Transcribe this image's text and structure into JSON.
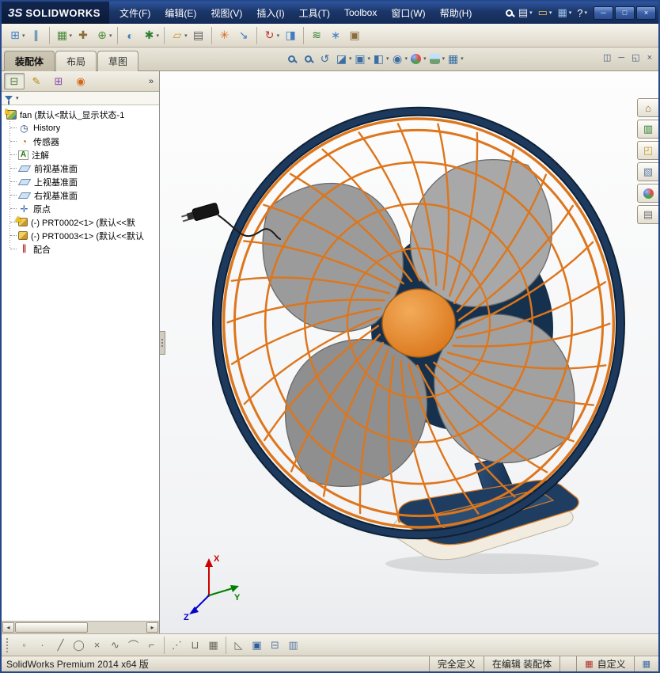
{
  "titlebar": {
    "logo_mark": "3S",
    "logo_text": "SOLIDWORKS",
    "menus": [
      "文件(F)",
      "编辑(E)",
      "视图(V)",
      "插入(I)",
      "工具(T)",
      "Toolbox",
      "窗口(W)",
      "帮助(H)"
    ],
    "quick_icons": [
      {
        "name": "search",
        "kind": "mag"
      },
      {
        "name": "new-document",
        "glyph": "▤",
        "color": "#e9eef7",
        "caret": true
      },
      {
        "name": "open",
        "glyph": "▭",
        "color": "#f0c050",
        "caret": true
      },
      {
        "name": "save",
        "glyph": "▦",
        "color": "#9cc2ee",
        "caret": true
      },
      {
        "name": "help",
        "glyph": "?",
        "color": "#ffffff",
        "caret": true
      }
    ],
    "window_controls": [
      {
        "name": "minimize",
        "glyph": "─"
      },
      {
        "name": "maximize",
        "glyph": "□"
      },
      {
        "name": "close",
        "glyph": "×"
      }
    ]
  },
  "toolbar": {
    "icons": [
      {
        "name": "insert-components",
        "glyph": "⊞",
        "color": "#3f7ec2",
        "caret": true
      },
      {
        "name": "mate",
        "glyph": "∥",
        "color": "#2e6da4"
      },
      {
        "name": "linear-component-pattern",
        "glyph": "▦",
        "color": "#4a8a3a",
        "caret": true,
        "sep": true
      },
      {
        "name": "smart-fasteners",
        "glyph": "✚",
        "color": "#8a6d3b"
      },
      {
        "name": "move-component",
        "glyph": "⊕",
        "color": "#4a8a3a",
        "caret": true
      },
      {
        "name": "show-hidden-components",
        "glyph": "◐",
        "color": "#3f7ec2",
        "sep": true
      },
      {
        "name": "assembly-features",
        "glyph": "✱",
        "color": "#2e7d32",
        "caret": true
      },
      {
        "name": "reference-geometry",
        "glyph": "▱",
        "color": "#c79a2e",
        "caret": true,
        "sep": true
      },
      {
        "name": "bill-of-materials",
        "glyph": "▤",
        "color": "#5a5a5a"
      },
      {
        "name": "exploded-view",
        "glyph": "✳",
        "color": "#d2691e",
        "sep": true
      },
      {
        "name": "instant-3d",
        "glyph": "↘",
        "color": "#3f7ec2"
      },
      {
        "name": "rebuild",
        "glyph": "↻",
        "color": "#c0392b",
        "caret": true,
        "sep": true
      },
      {
        "name": "snapshot",
        "glyph": "◨",
        "color": "#3f7ec2"
      },
      {
        "name": "motion-study",
        "glyph": "≋",
        "color": "#2e7d32",
        "sep": true
      },
      {
        "name": "measure",
        "glyph": "∗",
        "color": "#3f7ec2"
      },
      {
        "name": "mass-properties",
        "glyph": "▣",
        "color": "#8a6d3b"
      }
    ]
  },
  "band": {
    "tabs": [
      {
        "label": "装配体",
        "active": true
      },
      {
        "label": "布局",
        "active": false
      },
      {
        "label": "草图",
        "active": false
      }
    ],
    "headsup": [
      {
        "name": "zoom-to-fit",
        "kind": "mag"
      },
      {
        "name": "zoom-to-area",
        "kind": "mag"
      },
      {
        "name": "previous-view",
        "glyph": "↺",
        "color": "#3a6ea5"
      },
      {
        "name": "section-view",
        "glyph": "◪",
        "color": "#3a6ea5",
        "caret": true
      },
      {
        "name": "view-orientation",
        "glyph": "▣",
        "color": "#3a6ea5",
        "caret": true
      },
      {
        "name": "display-style",
        "glyph": "◧",
        "color": "#3a6ea5",
        "caret": true
      },
      {
        "name": "hide-show-items",
        "glyph": "◉",
        "color": "#3a6ea5",
        "caret": true
      },
      {
        "name": "edit-appearance",
        "kind": "ball",
        "caret": true
      },
      {
        "name": "apply-scene",
        "kind": "scene",
        "caret": true
      },
      {
        "name": "view-settings",
        "glyph": "▦",
        "color": "#3a6ea5",
        "caret": true
      }
    ],
    "doc_controls": [
      {
        "name": "viewport-layout",
        "glyph": "◫"
      },
      {
        "name": "doc-minimize",
        "glyph": "─"
      },
      {
        "name": "doc-restore",
        "glyph": "◱"
      },
      {
        "name": "doc-close",
        "glyph": "×"
      }
    ]
  },
  "panel": {
    "manager_tabs": [
      {
        "name": "feature-manager-tab",
        "glyph": "⊟",
        "color": "#4a7c2f",
        "active": true
      },
      {
        "name": "property-manager-tab",
        "glyph": "✎",
        "color": "#b8860b",
        "active": false
      },
      {
        "name": "configuration-manager-tab",
        "glyph": "⊞",
        "color": "#8e44ad",
        "active": false
      },
      {
        "name": "display-manager-tab",
        "glyph": "◉",
        "color": "#d2691e",
        "active": false
      }
    ],
    "overflow_glyph": "»",
    "tree": [
      {
        "icon": "assembly-icon",
        "warn": true,
        "label": "fan (默认<默认_显示状态-1"
      },
      {
        "icon": "history-icon",
        "warn": false,
        "label": "History"
      },
      {
        "icon": "sensors-icon",
        "warn": false,
        "label": "传感器"
      },
      {
        "icon": "annotations-icon",
        "warn": false,
        "label": "注解"
      },
      {
        "icon": "plane-icon",
        "warn": false,
        "label": "前视基准面"
      },
      {
        "icon": "plane-icon",
        "warn": false,
        "label": "上视基准面"
      },
      {
        "icon": "plane-icon",
        "warn": false,
        "label": "右视基准面"
      },
      {
        "icon": "origin-icon",
        "warn": false,
        "label": "原点"
      },
      {
        "icon": "part-icon",
        "warn": true,
        "label": "(-) PRT0002<1> (默认<<默"
      },
      {
        "icon": "part-icon",
        "warn": false,
        "label": "(-) PRT0003<1> (默认<<默认"
      },
      {
        "icon": "mates-icon",
        "warn": false,
        "label": "配合"
      }
    ]
  },
  "taskpane": [
    {
      "name": "solidworks-resources",
      "glyph": "⌂",
      "color": "#8a6d3b"
    },
    {
      "name": "design-library",
      "glyph": "▥",
      "color": "#2e7d32"
    },
    {
      "name": "file-explorer",
      "glyph": "◰",
      "color": "#c79a2e"
    },
    {
      "name": "view-palette",
      "glyph": "▧",
      "color": "#5b7aa5"
    },
    {
      "name": "appearances",
      "kind": "ball"
    },
    {
      "name": "custom-properties",
      "glyph": "▤",
      "color": "#707070"
    }
  ],
  "bottombar": [
    {
      "name": "select-tool",
      "glyph": "◦",
      "color": "#6b6b5e"
    },
    {
      "name": "sketch-point",
      "glyph": "·",
      "color": "#6b6b5e"
    },
    {
      "name": "sketch-line",
      "glyph": "╱",
      "color": "#6b6b5e"
    },
    {
      "name": "sketch-circle",
      "glyph": "◯",
      "color": "#6b6b5e"
    },
    {
      "name": "sketch-cross",
      "glyph": "×",
      "color": "#6b6b5e"
    },
    {
      "name": "sketch-spline",
      "glyph": "∿",
      "color": "#6b6b5e"
    },
    {
      "name": "sketch-arc",
      "glyph": "⌒",
      "color": "#6b6b5e"
    },
    {
      "name": "sketch-corner",
      "glyph": "⌐",
      "color": "#6b6b5e"
    },
    {
      "name": "sketch-points-pattern",
      "glyph": "⋰",
      "color": "#6b6b5e",
      "sep": true
    },
    {
      "name": "grid-snap",
      "glyph": "⊔",
      "color": "#6b6b5e"
    },
    {
      "name": "grid-display",
      "glyph": "▦",
      "color": "#6b6b5e"
    },
    {
      "name": "angle-snap",
      "glyph": "◺",
      "color": "#6b6b5e",
      "sep": true
    },
    {
      "name": "isometric-view-cube",
      "glyph": "▣",
      "color": "#2e5e9e"
    },
    {
      "name": "section-display",
      "glyph": "⊟",
      "color": "#5b7aa5"
    },
    {
      "name": "table-display",
      "glyph": "▥",
      "color": "#5b7aa5"
    }
  ],
  "statusbar": {
    "left": "SolidWorks Premium 2014 x64 版",
    "segments": [
      {
        "label": "完全定义",
        "icon": ""
      },
      {
        "label": "在编辑 装配体",
        "icon": ""
      },
      {
        "label": "",
        "icon": ""
      },
      {
        "label": "自定义",
        "icon": "▦",
        "icon_color": "#b03030"
      },
      {
        "label": "",
        "icon": "▦",
        "icon_color": "#3a6ea5"
      }
    ]
  },
  "viewport": {
    "triad": {
      "x": "X",
      "y": "Y",
      "z": "Z"
    }
  },
  "model": {
    "colors": {
      "guard": "#dd761c",
      "rim": "#1d3a5e",
      "rim_dark": "#0e2136",
      "blade": "#9d9d9d",
      "blade_edge": "#6a6a6a",
      "hub": "#e08a2e",
      "hub_dark": "#a85f12",
      "motor": "#16314d",
      "base_top": "#1f3c61",
      "base_panel": "#2a4d74",
      "base_cream": "#f1ecdf",
      "trim": "#d97a20",
      "cord": "#1b1b1b",
      "shadow": "rgba(0,0,0,0.10)"
    }
  }
}
